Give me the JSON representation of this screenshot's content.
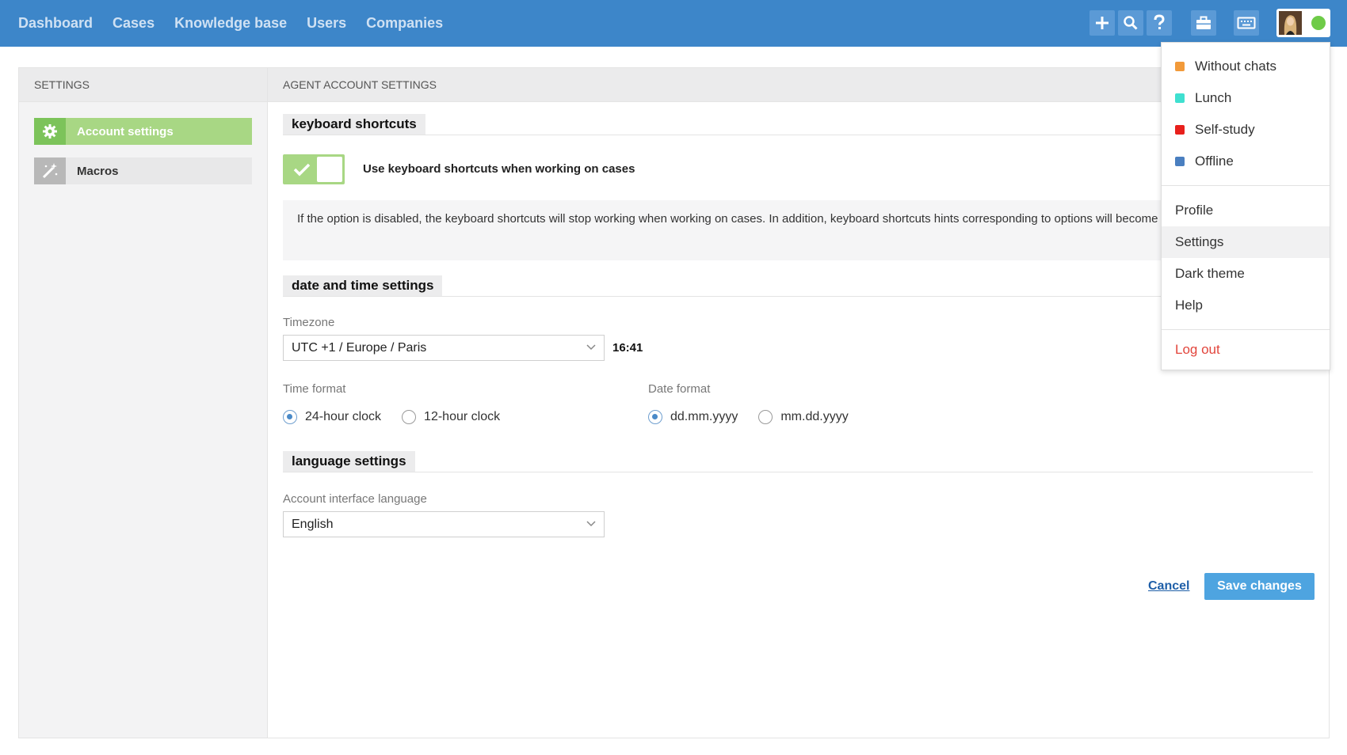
{
  "nav": {
    "items": [
      "Dashboard",
      "Cases",
      "Knowledge base",
      "Users",
      "Companies"
    ]
  },
  "toolbar": {
    "icons": [
      "plus-icon",
      "search-icon",
      "help-icon",
      "briefcase-icon",
      "keyboard-icon"
    ],
    "user_status_color": "#6ecb48"
  },
  "sidebar": {
    "header": "SETTINGS",
    "items": [
      {
        "label": "Account settings",
        "icon": "gear-icon",
        "active": true
      },
      {
        "label": "Macros",
        "icon": "magic-wand-icon",
        "active": false
      }
    ]
  },
  "content": {
    "header": "AGENT ACCOUNT SETTINGS",
    "keyboard": {
      "title": "keyboard shortcuts",
      "toggle_label": "Use keyboard shortcuts when working on cases",
      "toggle_on": true,
      "info": "If the option is disabled, the keyboard shortcuts will stop working when working on cases. In addition, keyboard shortcuts hints corresponding to options will become hidden."
    },
    "datetime": {
      "title": "date and time settings",
      "timezone_label": "Timezone",
      "timezone_value": "UTC +1 / Europe / Paris",
      "current_time": "16:41",
      "time_format_label": "Time format",
      "time_formats": [
        "24-hour clock",
        "12-hour clock"
      ],
      "time_format_selected": "24-hour clock",
      "date_format_label": "Date format",
      "date_formats": [
        "dd.mm.yyyy",
        "mm.dd.yyyy"
      ],
      "date_format_selected": "dd.mm.yyyy"
    },
    "language": {
      "title": "language settings",
      "label": "Account interface language",
      "value": "English"
    },
    "actions": {
      "cancel": "Cancel",
      "save": "Save changes"
    }
  },
  "user_menu": {
    "statuses": [
      {
        "label": "Without chats",
        "color": "#f29a3a"
      },
      {
        "label": "Lunch",
        "color": "#3fe0d0"
      },
      {
        "label": "Self-study",
        "color": "#e8201c"
      },
      {
        "label": "Offline",
        "color": "#4a7fc0"
      }
    ],
    "items": [
      "Profile",
      "Settings",
      "Dark theme",
      "Help"
    ],
    "hovered": "Settings",
    "logout": "Log out"
  },
  "colors": {
    "topbar": "#3d86c9",
    "accent_green": "#a8d784",
    "primary_button": "#4ea4e0",
    "logout_red": "#e2453c"
  }
}
